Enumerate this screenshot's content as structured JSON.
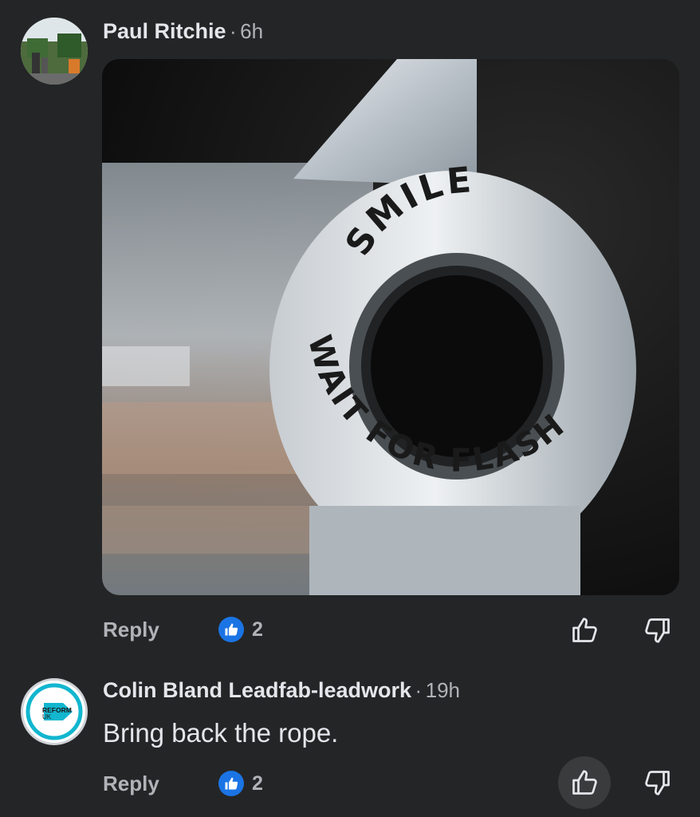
{
  "comments": [
    {
      "author": "Paul Ritchie",
      "separator": "·",
      "time": "6h",
      "reply_label": "Reply",
      "like_count": "2",
      "attachment": {
        "top_text": "SMILE",
        "bottom_text": "WAIT FOR FLASH"
      },
      "icons": [
        "thumbs-up-icon",
        "thumbs-down-icon"
      ]
    },
    {
      "author": "Colin Bland Leadfab-leadwork",
      "separator": "·",
      "time": "19h",
      "text": "Bring back the rope.",
      "reply_label": "Reply",
      "like_count": "2",
      "avatar_logo": {
        "line1": "REFORM",
        "line2": "UK"
      },
      "icons": [
        "thumbs-up-icon",
        "thumbs-down-icon"
      ]
    }
  ],
  "colors": {
    "background": "#242526",
    "text_primary": "#e4e6eb",
    "text_secondary": "#b0b3b8",
    "like_blue": "#1b74e4",
    "reform_teal": "#12b6cf"
  }
}
